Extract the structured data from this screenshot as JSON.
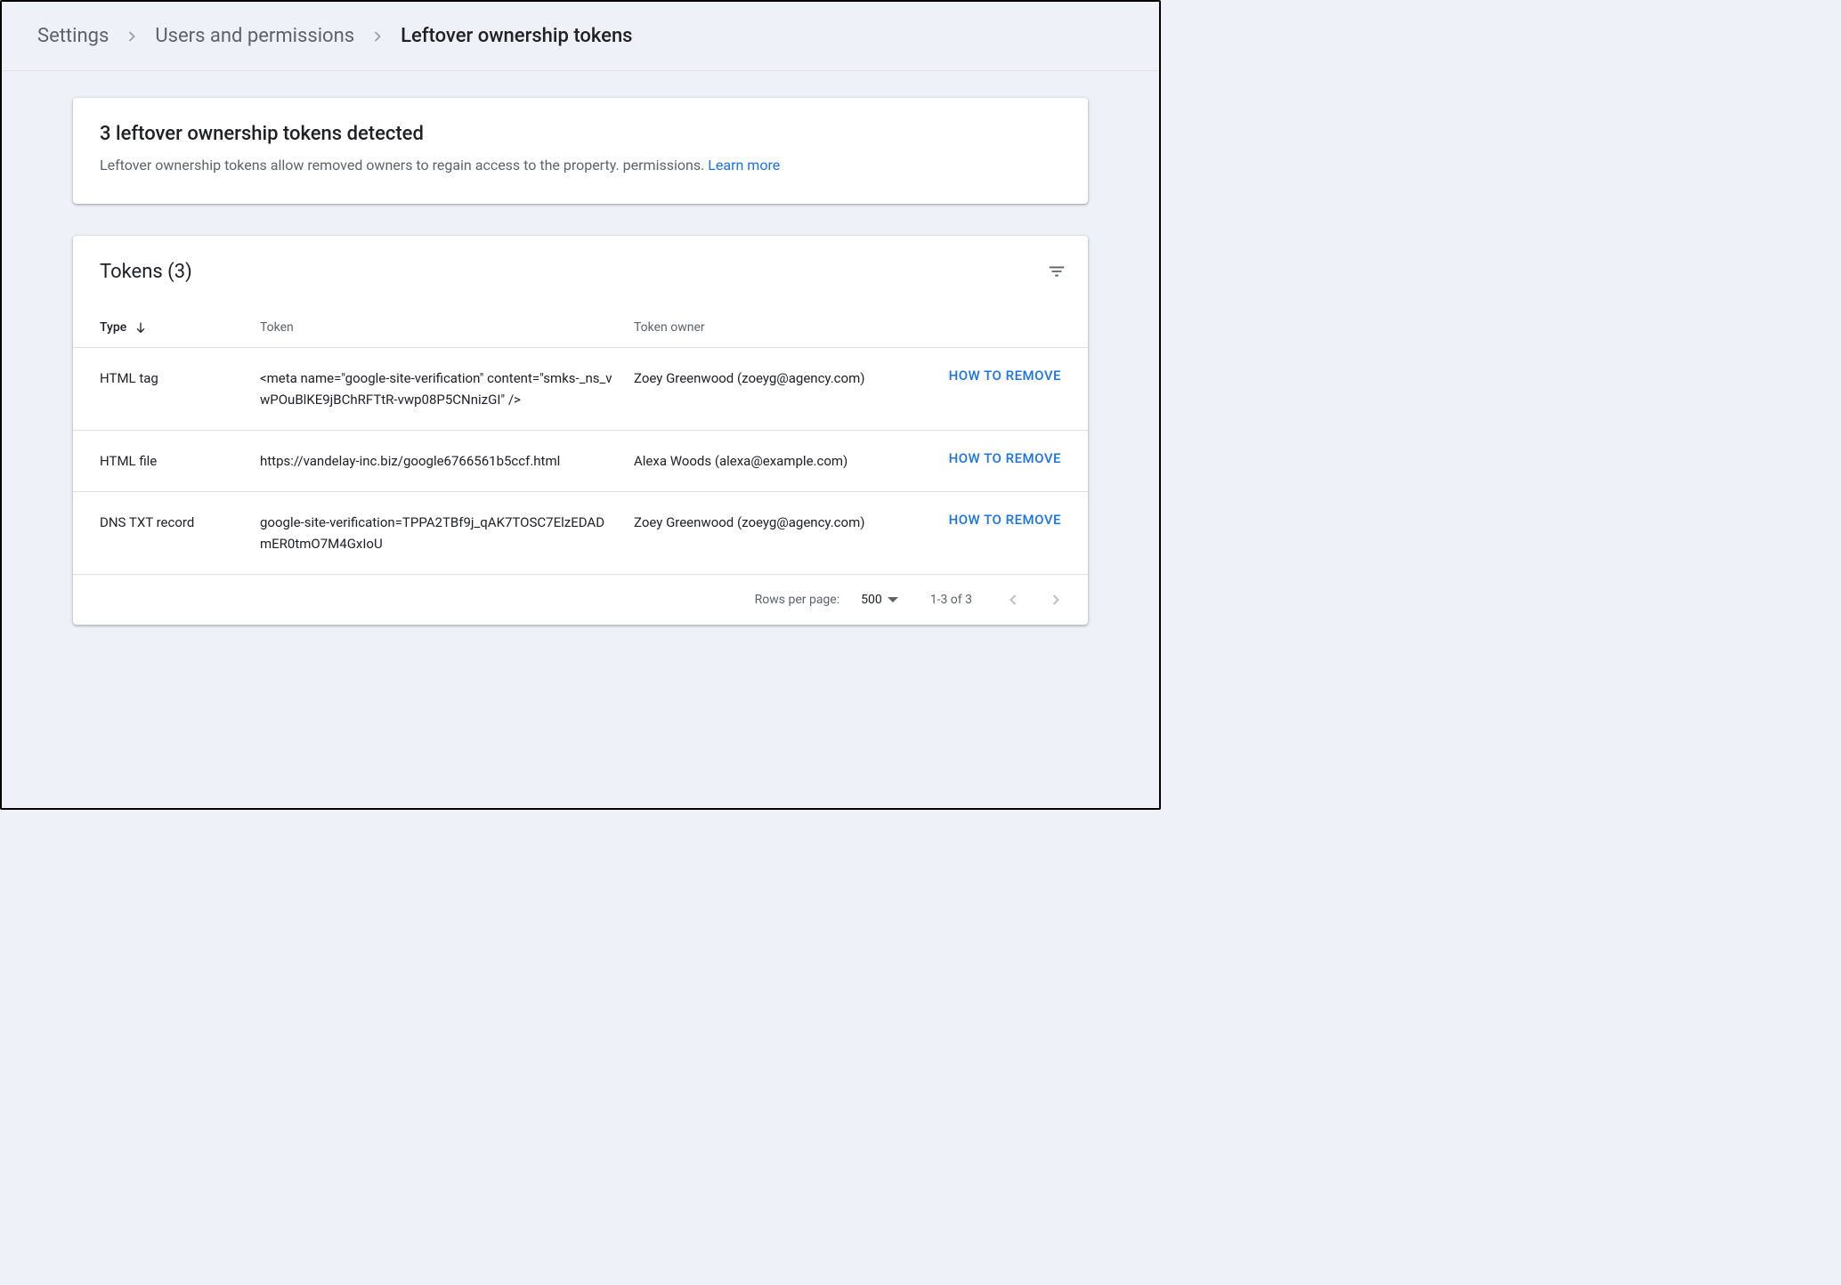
{
  "breadcrumb": {
    "items": [
      "Settings",
      "Users and permissions",
      "Leftover ownership tokens"
    ]
  },
  "notice": {
    "title": "3 leftover ownership tokens detected",
    "body": "Leftover ownership tokens allow removed owners to regain access to the property. permissions. ",
    "link_label": "Learn more"
  },
  "table": {
    "title": "Tokens (3)",
    "filter_icon": "filter-list-icon",
    "columns": {
      "type": "Type",
      "token": "Token",
      "owner": "Token owner"
    },
    "sort": {
      "column": "type",
      "direction": "down"
    },
    "action_label": "HOW TO REMOVE",
    "rows": [
      {
        "type": "HTML tag",
        "token": "<meta name=\"google-site-verification\" content=\"smks-_ns_vwPOuBlKE9jBChRFTtR-vwp08P5CNnizGI\" />",
        "owner": "Zoey Greenwood (zoeyg@agency.com)"
      },
      {
        "type": "HTML file",
        "token": "https://vandelay-inc.biz/google6766561b5ccf.html",
        "owner": "Alexa Woods (alexa@example.com)"
      },
      {
        "type": "DNS TXT record",
        "token": "google-site-verification=TPPA2TBf9j_qAK7TOSC7ElzEDADmER0tmO7M4GxIoU",
        "owner": "Zoey Greenwood (zoeyg@agency.com)"
      }
    ],
    "footer": {
      "rows_per_page_label": "Rows per page:",
      "rows_per_page_value": "500",
      "range_label": "1-3 of 3"
    }
  }
}
